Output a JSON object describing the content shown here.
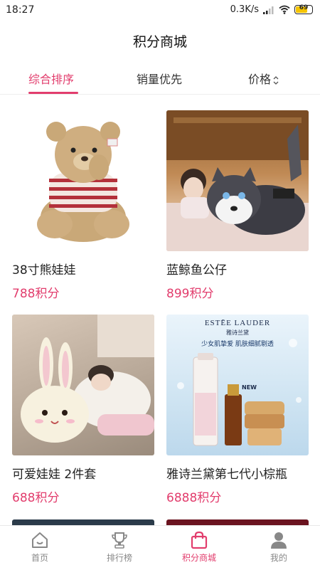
{
  "status": {
    "time": "18:27",
    "speed": "0.3K/s",
    "battery": "69"
  },
  "header": {
    "title": "积分商城"
  },
  "tabs": [
    {
      "label": "综合排序",
      "active": true
    },
    {
      "label": "销量优先",
      "active": false
    },
    {
      "label": "价格",
      "active": false
    }
  ],
  "products": [
    {
      "name": "38寸熊娃娃",
      "price": "788积分",
      "image": "teddy-bear"
    },
    {
      "name": "蓝鲸鱼公仔",
      "price": "899积分",
      "image": "husky-plush"
    },
    {
      "name": "可爱娃娃 2件套",
      "price": "688积分",
      "image": "bunny-plush"
    },
    {
      "name": "雅诗兰黛第七代小棕瓶",
      "price": "6888积分",
      "image": "estee-lauder",
      "brand": "ESTĒE LAUDER",
      "brand_cn": "雅诗兰黛",
      "tagline": "少女肌挚爱 肌肤细腻剔透",
      "badge": "NEW"
    }
  ],
  "nav": [
    {
      "label": "首页",
      "icon": "home-icon",
      "active": false
    },
    {
      "label": "排行榜",
      "icon": "trophy-icon",
      "active": false
    },
    {
      "label": "积分商城",
      "icon": "shopping-bag-icon",
      "active": true
    },
    {
      "label": "我的",
      "icon": "user-icon",
      "active": false
    }
  ],
  "colors": {
    "accent": "#e23d6d",
    "text": "#222222",
    "muted": "#888888"
  }
}
